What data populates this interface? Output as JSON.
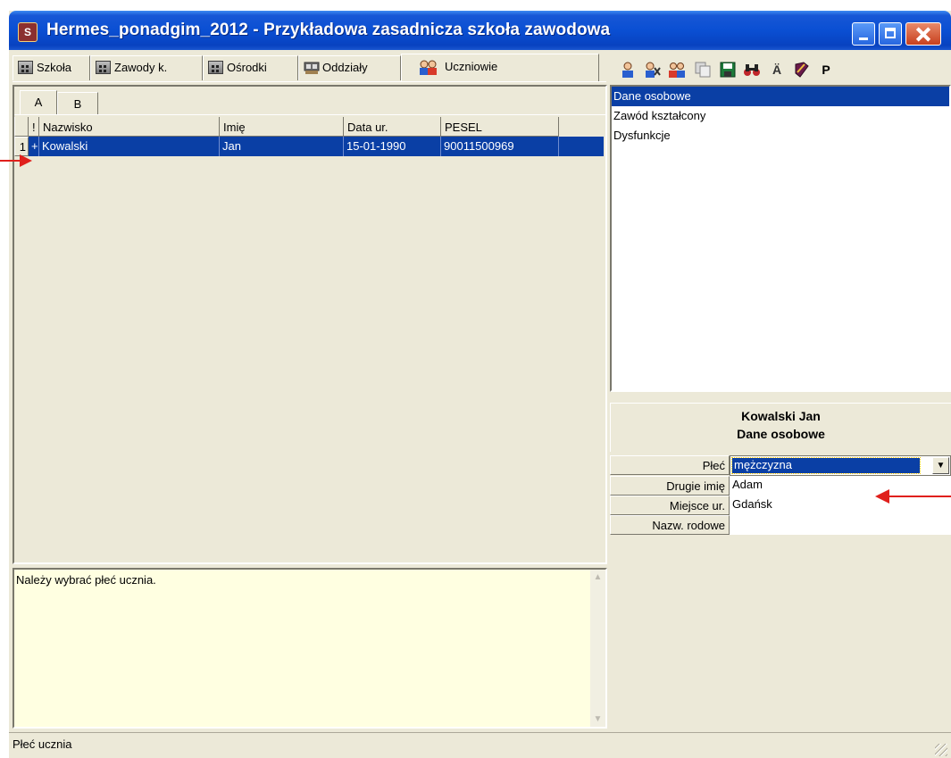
{
  "window": {
    "title": "Hermes_ponadgim_2012 - Przykładowa zasadnicza szkoła zawodowa",
    "icon_letter": "S"
  },
  "main_tabs": [
    {
      "label": "Szkoła",
      "icon": "building-icon"
    },
    {
      "label": "Zawody k.",
      "icon": "building-icon"
    },
    {
      "label": "Ośrodki",
      "icon": "building-icon"
    },
    {
      "label": "Oddziały",
      "icon": "classroom-icon"
    },
    {
      "label": "Uczniowie",
      "icon": "students-icon",
      "active": true
    }
  ],
  "toolbar": {
    "umlaut_label": "Ä",
    "p_label": "P"
  },
  "grid": {
    "sub_tabs": [
      "A",
      "B"
    ],
    "columns": [
      "!",
      "Nazwisko",
      "Imię",
      "Data ur.",
      "PESEL"
    ],
    "rows": [
      {
        "num": "1",
        "flag": "+",
        "nazwisko": "Kowalski",
        "imie": "Jan",
        "data_ur": "15-01-1990",
        "pesel": "90011500969"
      }
    ]
  },
  "right_list": {
    "items": [
      "Dane osobowe",
      "Zawód kształcony",
      "Dysfunkcje"
    ],
    "selected": 0
  },
  "detail": {
    "header_name": "Kowalski Jan",
    "header_section": "Dane osobowe",
    "fields": [
      {
        "label": "Płeć",
        "value": "mężczyzna"
      },
      {
        "label": "Drugie imię",
        "value": "Adam"
      },
      {
        "label": "Miejsce ur.",
        "value": "Gdańsk"
      },
      {
        "label": "Nazw. rodowe",
        "value": ""
      }
    ]
  },
  "message": "Należy wybrać płeć ucznia.",
  "status": "Płeć ucznia",
  "colors": {
    "titlebar": "#0a4fd3",
    "selection": "#0a3fa5",
    "annotation_arrow": "#e0201c",
    "window_bg": "#ece9d8",
    "message_bg": "#ffffe1"
  }
}
